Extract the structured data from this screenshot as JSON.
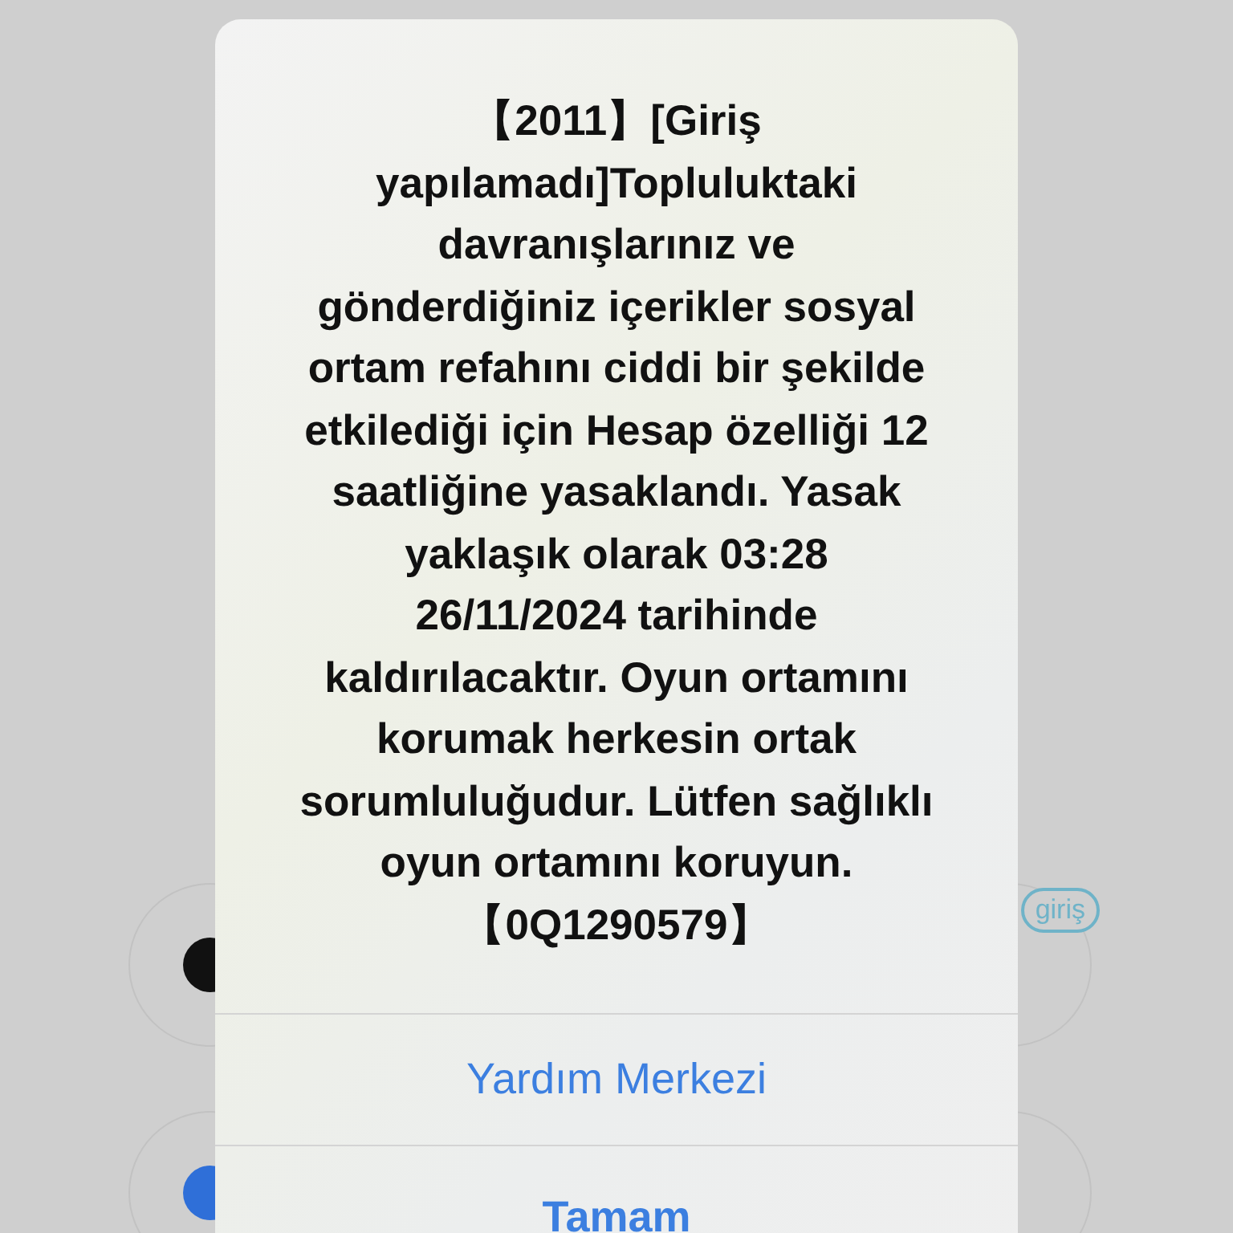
{
  "background": {
    "badge": "giriş",
    "options": [
      {
        "kind": "dark"
      },
      {
        "kind": "blue"
      }
    ]
  },
  "dialog": {
    "message": "【2011】[Giriş yapılamadı]Topluluktaki davranışlarınız ve gönderdiğiniz içerikler sosyal ortam refahını ciddi bir şekilde etkilediği için Hesap özelliği 12 saatliğine yasaklandı. Yasak yaklaşık olarak 03:28 26/11/2024 tarihinde kaldırılacaktır. Oyun ortamını korumak herkesin ortak sorumluluğudur. Lütfen sağlıklı oyun ortamını koruyun. 【0Q1290579】",
    "buttons": [
      {
        "label": "Yardım Merkezi",
        "primary": false
      },
      {
        "label": "Tamam",
        "primary": true
      }
    ]
  }
}
